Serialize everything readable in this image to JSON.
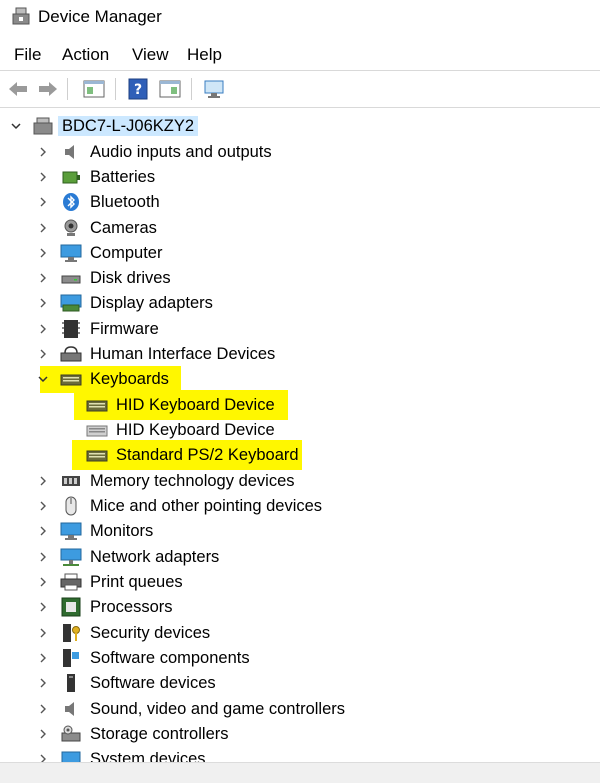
{
  "window": {
    "title": "Device Manager"
  },
  "menu": [
    "File",
    "Action",
    "View",
    "Help"
  ],
  "tree": {
    "root": "BDC7-L-J06KZY2",
    "categories": [
      {
        "label": "Audio inputs and outputs",
        "icon": "speaker-icon",
        "expanded": false
      },
      {
        "label": "Batteries",
        "icon": "battery-icon",
        "expanded": false
      },
      {
        "label": "Bluetooth",
        "icon": "bluetooth-icon",
        "expanded": false
      },
      {
        "label": "Cameras",
        "icon": "camera-icon",
        "expanded": false
      },
      {
        "label": "Computer",
        "icon": "monitor-icon",
        "expanded": false
      },
      {
        "label": "Disk drives",
        "icon": "disk-drive-icon",
        "expanded": false
      },
      {
        "label": "Display adapters",
        "icon": "display-adapter-icon",
        "expanded": false
      },
      {
        "label": "Firmware",
        "icon": "firmware-icon",
        "expanded": false
      },
      {
        "label": "Human Interface Devices",
        "icon": "hid-icon",
        "expanded": false
      },
      {
        "label": "Keyboards",
        "icon": "keyboard-icon",
        "expanded": true,
        "highlighted": true,
        "children": [
          {
            "label": "HID Keyboard Device",
            "icon": "keyboard-icon",
            "highlighted": true
          },
          {
            "label": "HID Keyboard Device",
            "icon": "keyboard-icon",
            "highlighted": false
          },
          {
            "label": "Standard PS/2 Keyboard",
            "icon": "keyboard-icon",
            "highlighted": true
          }
        ]
      },
      {
        "label": "Memory technology devices",
        "icon": "memory-icon",
        "expanded": false
      },
      {
        "label": "Mice and other pointing devices",
        "icon": "mouse-icon",
        "expanded": false
      },
      {
        "label": "Monitors",
        "icon": "monitor-icon",
        "expanded": false
      },
      {
        "label": "Network adapters",
        "icon": "network-icon",
        "expanded": false
      },
      {
        "label": "Print queues",
        "icon": "printer-icon",
        "expanded": false
      },
      {
        "label": "Processors",
        "icon": "processor-icon",
        "expanded": false
      },
      {
        "label": "Security devices",
        "icon": "security-icon",
        "expanded": false
      },
      {
        "label": "Software components",
        "icon": "software-component-icon",
        "expanded": false
      },
      {
        "label": "Software devices",
        "icon": "software-device-icon",
        "expanded": false
      },
      {
        "label": "Sound, video and game controllers",
        "icon": "speaker-icon",
        "expanded": false
      },
      {
        "label": "Storage controllers",
        "icon": "storage-icon",
        "expanded": false
      },
      {
        "label": "System devices",
        "icon": "system-icon",
        "expanded": false
      }
    ]
  },
  "colors": {
    "highlight": "#fff700",
    "accent": "#2a7bd4"
  }
}
